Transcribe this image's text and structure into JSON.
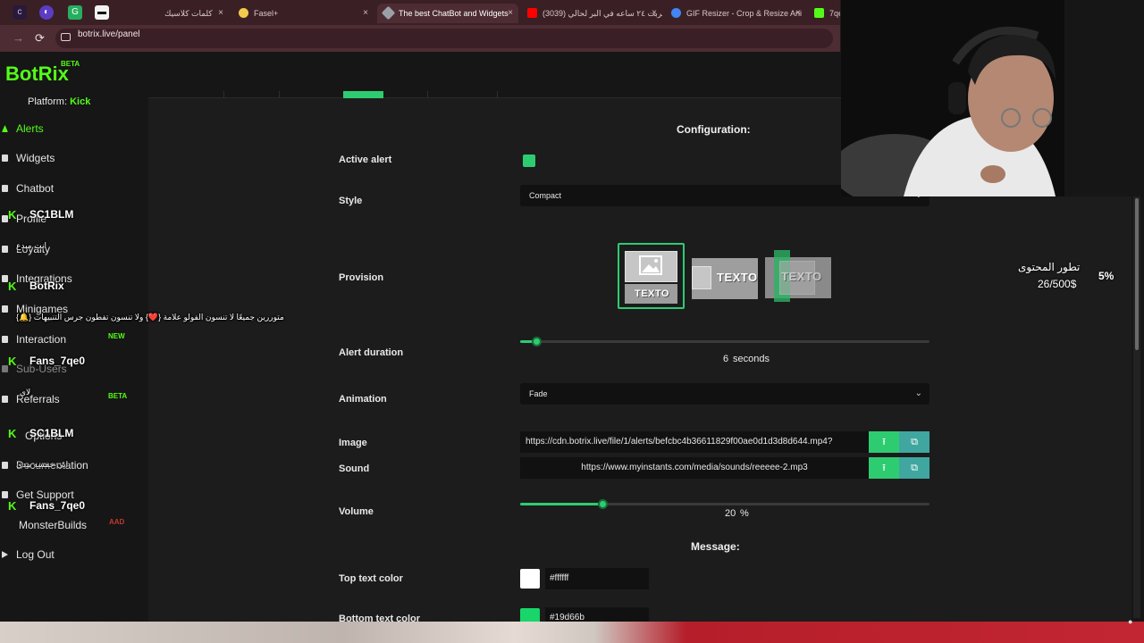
{
  "browser": {
    "tabs": [
      {
        "title": "كلمات كلاسيك",
        "fav": "#aaaaaa"
      },
      {
        "title": "Fasel+",
        "fav": "#f2c94c"
      },
      {
        "title": "The best ChatBot and Widgets",
        "fav": "#9aa0a6"
      },
      {
        "title": "(3039) جربت ٢٤ ساعه في البر لحالي",
        "fav": "#ff0000"
      },
      {
        "title": "GIF Resizer - Crop & Resize Ani",
        "fav": "#4285f4"
      },
      {
        "title": "7qe",
        "fav": "#53fc18"
      }
    ],
    "tab_close": "×",
    "url": "botrix.live/panel",
    "back": "←",
    "forward": "→",
    "reload": "⟳",
    "ext_icons": [
      "c",
      "◐",
      "G",
      "▬"
    ]
  },
  "app": {
    "logo": "BotRix",
    "beta": "BETA",
    "platform_label": "Platform:",
    "platform_value": "Kick",
    "sidebar": [
      {
        "label": "Alerts",
        "active": true
      },
      {
        "label": "Widgets"
      },
      {
        "label": "Chatbot"
      },
      {
        "label": "Profile"
      },
      {
        "label": "Loyalty"
      },
      {
        "label": "Integrations"
      },
      {
        "label": "Minigames"
      },
      {
        "label": "Interaction",
        "badge": "NEW"
      },
      {
        "label": "Sub-Users"
      },
      {
        "label": "Referrals",
        "badge": "BETA"
      },
      {
        "label": "Options"
      },
      {
        "label": "Documentation"
      },
      {
        "label": "Get Support"
      },
      {
        "label": "MonsterBuilds",
        "badge": "AAD"
      },
      {
        "label": "Log Out"
      }
    ]
  },
  "chat_overlay": {
    "names": [
      "SC1BLM",
      "BotRix",
      "Fans_7qe0",
      "SC1BLM",
      "Fans_7qe0"
    ],
    "msg1": "انت مبدع",
    "msg2": "{🔔} متوررين جميعًا لا تنسون الفولو علامة {❤️} ولا تنسون تفطون جرس التنبيهات",
    "msg3": "لاي",
    "msg4": "ابي خمسه بيدي"
  },
  "config": {
    "title": "Configuration:",
    "active_alert_label": "Active alert",
    "style_label": "Style",
    "style_value": "Compact",
    "provision_label": "Provision",
    "provision_text": "TEXTO",
    "alert_duration_label": "Alert duration",
    "alert_duration_value": "6",
    "alert_duration_unit": "seconds",
    "alert_duration_fraction": 0.04,
    "animation_label": "Animation",
    "animation_value": "Fade",
    "image_label": "Image",
    "image_url": "https://cdn.botrix.live/file/1/alerts/befcbc4b36611829f00ae0d1d3d8d644.mp4?",
    "sound_label": "Sound",
    "sound_url": "https://www.myinstants.com/media/sounds/reeeee-2.mp3",
    "volume_label": "Volume",
    "volume_value": "20",
    "volume_unit": "%",
    "volume_fraction": 0.2,
    "message_title": "Message:",
    "top_color_label": "Top text color",
    "top_color_value": "#ffffff",
    "bottom_color_label": "Bottom text color",
    "bottom_color_value": "#19d66b",
    "upload_icon": "⭱",
    "gallery_icon": "⧉",
    "chevron": "⌄"
  },
  "overlay": {
    "goal_title": "تطور المحتوى",
    "goal_progress": "26/500$",
    "goal_percent": "5%"
  },
  "colors": {
    "accent": "#2ecc71",
    "kick": "#53fc18"
  }
}
